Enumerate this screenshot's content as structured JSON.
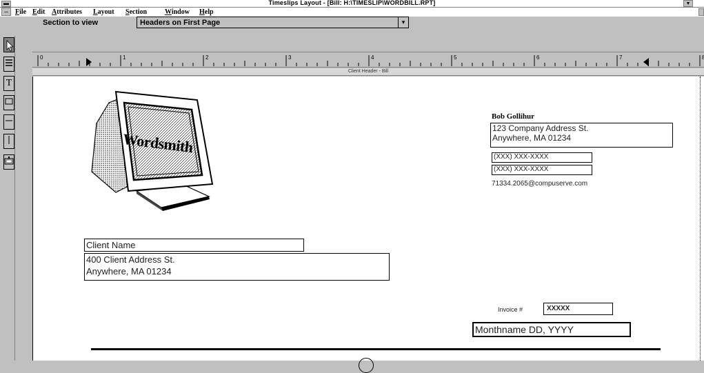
{
  "window": {
    "title": "Timeslips Layout - [Bill: H:\\TIMESLIP\\WORDBILL.RPT]"
  },
  "menu": {
    "items": [
      "File",
      "Edit",
      "Attributes",
      "Layout",
      "Section",
      "Window",
      "Help"
    ]
  },
  "section_bar": {
    "label": "Section to view",
    "selected": "Headers on First Page"
  },
  "ruler": {
    "numbers": [
      "0",
      "1",
      "2",
      "3",
      "4",
      "5",
      "6",
      "7",
      "8"
    ]
  },
  "section_strip": {
    "label": "Client Header - Bill"
  },
  "logo": {
    "text": "Wordsmith"
  },
  "company": {
    "name": "Bob Gollihur",
    "address_line1": "123 Company Address St.",
    "address_line2": "Anywhere, MA 01234",
    "phone1": "(XXX) XXX-XXXX",
    "phone2": "(XXX) XXX-XXXX",
    "email": "71334.2065@compuserve.com"
  },
  "client": {
    "name": "Client Name",
    "address_line1": "400 Client Address St.",
    "address_line2": "Anywhere, MA 01234"
  },
  "invoice": {
    "label": "Invoice #",
    "number": "XXXXX",
    "date": "Monthname DD, YYYY"
  },
  "tools": [
    "pointer-tool",
    "line-tool",
    "text-tool",
    "rectangle-tool",
    "horizontal-line-tool",
    "vertical-line-tool",
    "field-tool"
  ]
}
